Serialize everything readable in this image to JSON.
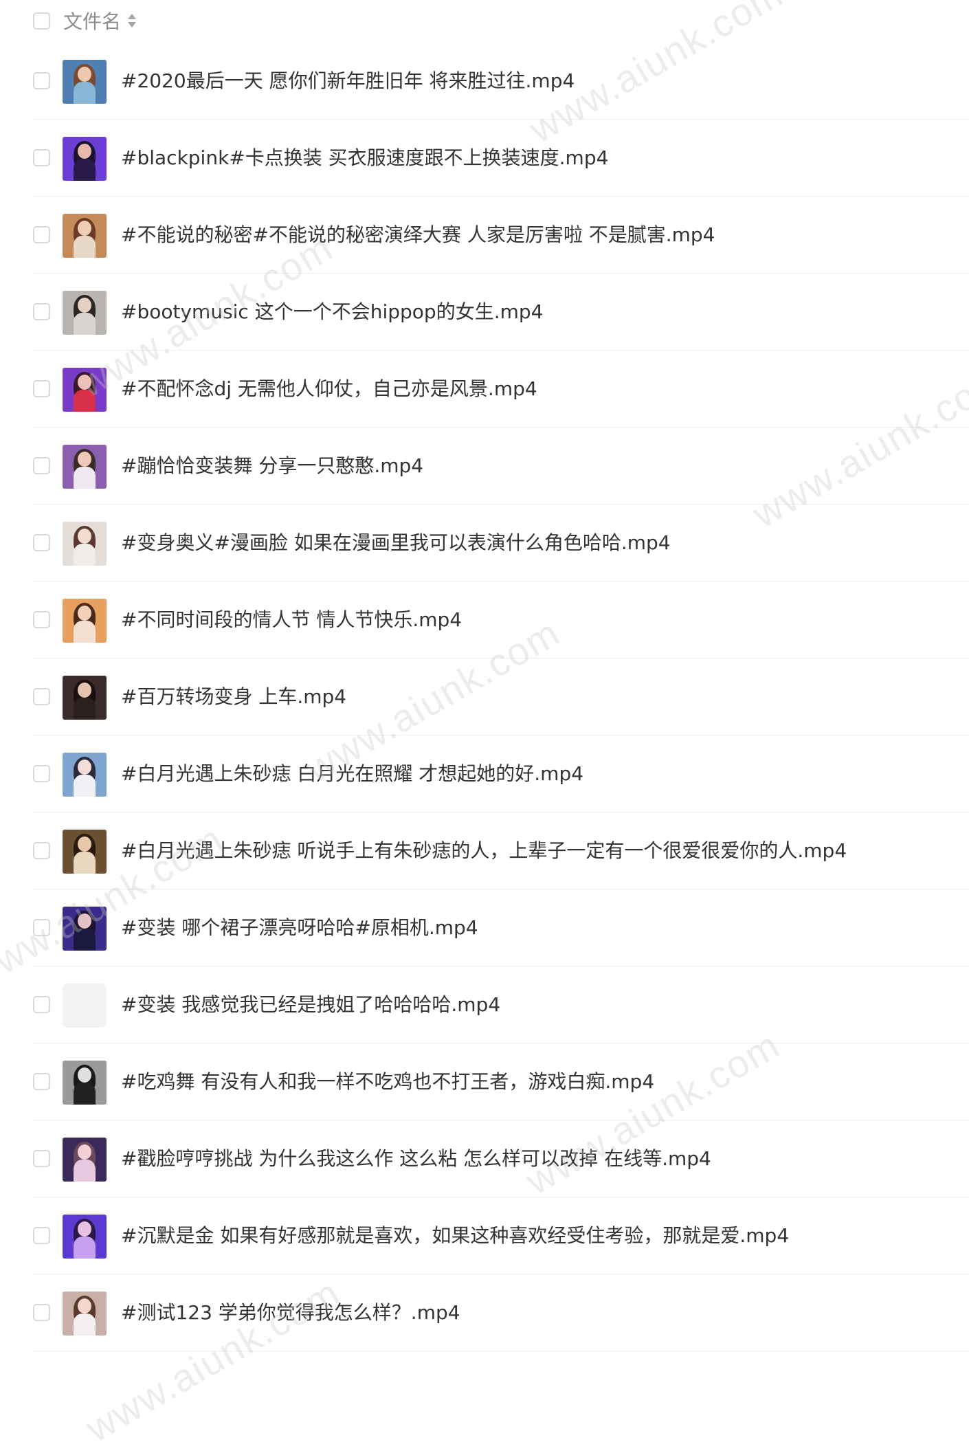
{
  "header": {
    "column_label": "文件名",
    "sort_icon": "sort-icon"
  },
  "files": [
    {
      "name": "#2020最后一天 愿你们新年胜旧年 将来胜过往.mp4",
      "thumb": {
        "bg": "#4f7fb3",
        "skin": "#f0c8b0",
        "hair": "#7a4a32",
        "cloth": "#8ab6d6"
      }
    },
    {
      "name": "#blackpink#卡点换装 买衣服速度跟不上换装速度.mp4",
      "thumb": {
        "bg": "#6b3fd6",
        "skin": "#e8b8a8",
        "hair": "#1a1230",
        "cloth": "#2a1a4a"
      }
    },
    {
      "name": "#不能说的秘密#不能说的秘密演绎大赛 人家是厉害啦 不是腻害.mp4",
      "thumb": {
        "bg": "#c58a5a",
        "skin": "#f3cdb5",
        "hair": "#6b3a22",
        "cloth": "#e8d8c8"
      }
    },
    {
      "name": "#bootymusic 这个一个不会hippop的女生.mp4",
      "thumb": {
        "bg": "#b8b4b0",
        "skin": "#e6d0c4",
        "hair": "#2a2624",
        "cloth": "#d8d4d0"
      }
    },
    {
      "name": "#不配怀念dj 无需他人仰仗，自己亦是风景.mp4",
      "thumb": {
        "bg": "#7a3cc8",
        "skin": "#f0c0b8",
        "hair": "#3a1a2a",
        "cloth": "#d8304a"
      }
    },
    {
      "name": "#蹦恰恰变装舞 分享一只憨憨.mp4",
      "thumb": {
        "bg": "#8a5fb0",
        "skin": "#f0c8b8",
        "hair": "#3a2a28",
        "cloth": "#f0e8f0"
      }
    },
    {
      "name": "#变身奥义#漫画脸 如果在漫画里我可以表演什么角色哈哈.mp4",
      "thumb": {
        "bg": "#e4ddd8",
        "skin": "#f4dcd0",
        "hair": "#5a3a30",
        "cloth": "#f0ece8"
      }
    },
    {
      "name": "#不同时间段的情人节 情人节快乐.mp4",
      "thumb": {
        "bg": "#e8a060",
        "skin": "#f4d0b8",
        "hair": "#4a2a1a",
        "cloth": "#f4e0d0"
      }
    },
    {
      "name": "#百万转场变身 上车.mp4",
      "thumb": {
        "bg": "#3a2a2a",
        "skin": "#e8c4b0",
        "hair": "#1a1010",
        "cloth": "#2a2020"
      }
    },
    {
      "name": "#白月光遇上朱砂痣 白月光在照耀 才想起她的好.mp4",
      "thumb": {
        "bg": "#7fa4d0",
        "skin": "#f4dcd8",
        "hair": "#2a2a3a",
        "cloth": "#f0f0f4"
      }
    },
    {
      "name": "#白月光遇上朱砂痣 听说手上有朱砂痣的人，上辈子一定有一个很爱很爱你的人.mp4",
      "thumb": {
        "bg": "#6a5030",
        "skin": "#e8c8a8",
        "hair": "#2a1a10",
        "cloth": "#e8d8c0"
      }
    },
    {
      "name": "#变装 哪个裙子漂亮呀哈哈#原相机.mp4",
      "thumb": {
        "bg": "#3a2a8a",
        "skin": "#e8c0c8",
        "hair": "#1a1430",
        "cloth": "#1a1a40"
      }
    },
    {
      "name": "#变装 我感觉我已经是拽姐了哈哈哈哈.mp4",
      "thumb": {
        "bg": "#f2f2f2",
        "skin": "",
        "hair": "",
        "cloth": ""
      }
    },
    {
      "name": "#吃鸡舞 有没有人和我一样不吃鸡也不打王者，游戏白痴.mp4",
      "thumb": {
        "bg": "#9a9a9a",
        "skin": "#e0e0e0",
        "hair": "#1a1a1a",
        "cloth": "#222222"
      }
    },
    {
      "name": "#戳脸哼哼挑战 为什么我这么作 这么粘 怎么样可以改掉 在线等.mp4",
      "thumb": {
        "bg": "#3a2a5a",
        "skin": "#f4d0d4",
        "hair": "#6a4a5a",
        "cloth": "#e8c8e0"
      }
    },
    {
      "name": "#沉默是金 如果有好感那就是喜欢，如果这种喜欢经受住考验，那就是爱.mp4",
      "thumb": {
        "bg": "#5a3ad0",
        "skin": "#e8c0e0",
        "hair": "#2a1a4a",
        "cloth": "#c8a0f0"
      }
    },
    {
      "name": "#测试123 学弟你觉得我怎么样？.mp4",
      "thumb": {
        "bg": "#c8b0a8",
        "skin": "#f4d8cc",
        "hair": "#5a3a2a",
        "cloth": "#f4f0f0"
      }
    }
  ],
  "watermark": {
    "text": "www.aiunk.com"
  }
}
